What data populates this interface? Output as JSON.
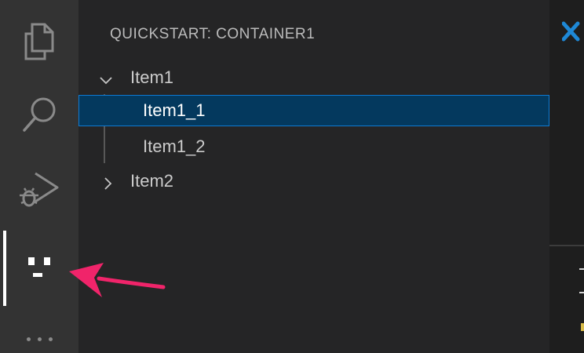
{
  "activity_bar": {
    "items": [
      {
        "icon": "files-icon"
      },
      {
        "icon": "search-icon"
      },
      {
        "icon": "run-debug-icon"
      },
      {
        "icon": "custom-view-icon",
        "active": true
      }
    ],
    "more_icon": "more-ellipsis-icon"
  },
  "sidebar": {
    "title": "QUICKSTART: CONTAINER1",
    "tree": [
      {
        "label": "Item1",
        "expanded": true,
        "children": [
          {
            "label": "Item1_1",
            "selected": true
          },
          {
            "label": "Item1_2"
          }
        ]
      },
      {
        "label": "Item2",
        "expanded": false
      }
    ]
  },
  "annotation": {
    "arrow_color": "#f0246a",
    "points_to": "custom-view-icon"
  },
  "colors": {
    "selection_bg": "#04395e",
    "selection_border": "#0e7ad3",
    "accent_blue": "#1e88d6"
  }
}
